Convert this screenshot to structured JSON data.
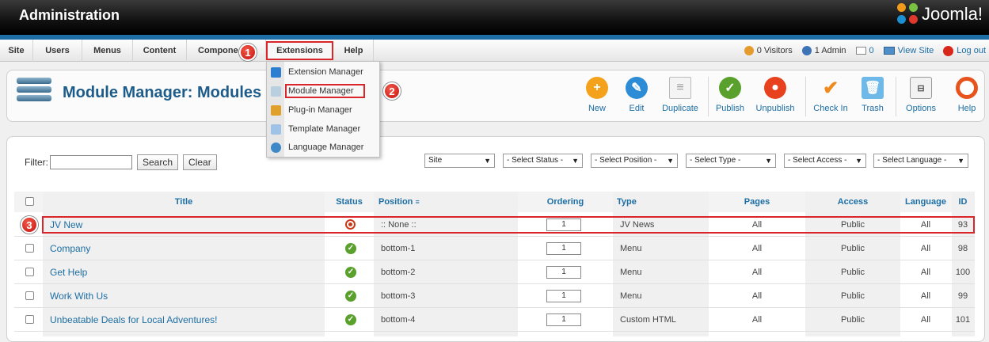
{
  "header": {
    "title": "Administration",
    "brand": "Joomla!"
  },
  "menu": {
    "items": [
      "Site",
      "Users",
      "Menus",
      "Content",
      "Compone",
      "Extensions",
      "Help"
    ],
    "status": {
      "visitors": "0 Visitors",
      "admins": "1 Admin",
      "messages": "0",
      "view_site": "View Site",
      "logout": "Log out"
    }
  },
  "dropdown": {
    "items": [
      "Extension Manager",
      "Module Manager",
      "Plug-in Manager",
      "Template Manager",
      "Language Manager"
    ],
    "highlighted": "Module Manager"
  },
  "badges": [
    "1",
    "2",
    "3"
  ],
  "toolbar": {
    "page_title": "Module Manager: Modules",
    "buttons": {
      "new": "New",
      "edit": "Edit",
      "duplicate": "Duplicate",
      "publish": "Publish",
      "unpublish": "Unpublish",
      "checkin": "Check In",
      "trash": "Trash",
      "options": "Options",
      "help": "Help"
    }
  },
  "filter": {
    "label": "Filter:",
    "value": "",
    "search": "Search",
    "clear": "Clear",
    "selects": {
      "client": "Site",
      "status": "- Select Status -",
      "position": "- Select Position -",
      "type": "- Select Type -",
      "access": "- Select Access -",
      "language": "- Select Language -"
    }
  },
  "table": {
    "headers": {
      "title": "Title",
      "status": "Status",
      "position": "Position",
      "ordering": "Ordering",
      "type": "Type",
      "pages": "Pages",
      "access": "Access",
      "language": "Language",
      "id": "ID"
    },
    "rows": [
      {
        "title": "JV New",
        "status": "unpublished",
        "position": ":: None ::",
        "ordering": "1",
        "type": "JV News",
        "pages": "All",
        "access": "Public",
        "language": "All",
        "id": "93"
      },
      {
        "title": "Company",
        "status": "published",
        "position": "bottom-1",
        "ordering": "1",
        "type": "Menu",
        "pages": "All",
        "access": "Public",
        "language": "All",
        "id": "98"
      },
      {
        "title": "Get Help",
        "status": "published",
        "position": "bottom-2",
        "ordering": "1",
        "type": "Menu",
        "pages": "All",
        "access": "Public",
        "language": "All",
        "id": "100"
      },
      {
        "title": "Work With Us",
        "status": "published",
        "position": "bottom-3",
        "ordering": "1",
        "type": "Menu",
        "pages": "All",
        "access": "Public",
        "language": "All",
        "id": "99"
      },
      {
        "title": "Unbeatable Deals for Local Adventures!",
        "status": "published",
        "position": "bottom-4",
        "ordering": "1",
        "type": "Custom HTML",
        "pages": "All",
        "access": "Public",
        "language": "All",
        "id": "101"
      }
    ]
  },
  "colors": {
    "accent": "#1c6ea4",
    "highlight": "#d9262b",
    "published": "#5aa02c",
    "unpublished": "#c93a1a"
  }
}
